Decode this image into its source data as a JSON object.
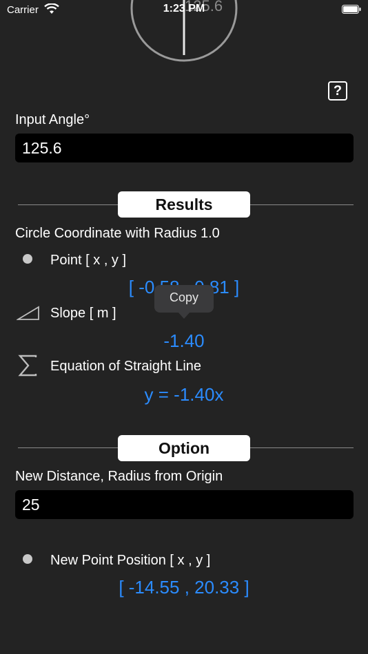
{
  "status": {
    "carrier": "Carrier",
    "time": "1:23 PM"
  },
  "dial": {
    "value": "125.6"
  },
  "help": {
    "label": "?"
  },
  "input_angle": {
    "label": "Input Angle°",
    "value": "125.6"
  },
  "results": {
    "header": "Results",
    "circle_label": "Circle Coordinate with Radius 1.0",
    "point_label": "Point [ x , y ]",
    "point_value": "[ -0.58 , 0.81 ]",
    "slope_label": "Slope [ m ]",
    "slope_value": "-1.40",
    "equation_label": "Equation of Straight Line",
    "equation_value": "y = -1.40x",
    "tooltip": "Copy"
  },
  "option": {
    "header": "Option",
    "distance_label": "New Distance, Radius from Origin",
    "distance_value": "25",
    "new_point_label": "New Point Position [ x , y ]",
    "new_point_value": "[ -14.55 , 20.33 ]"
  },
  "colors": {
    "accent": "#2b8cff",
    "background": "#232323",
    "field": "#000000"
  }
}
